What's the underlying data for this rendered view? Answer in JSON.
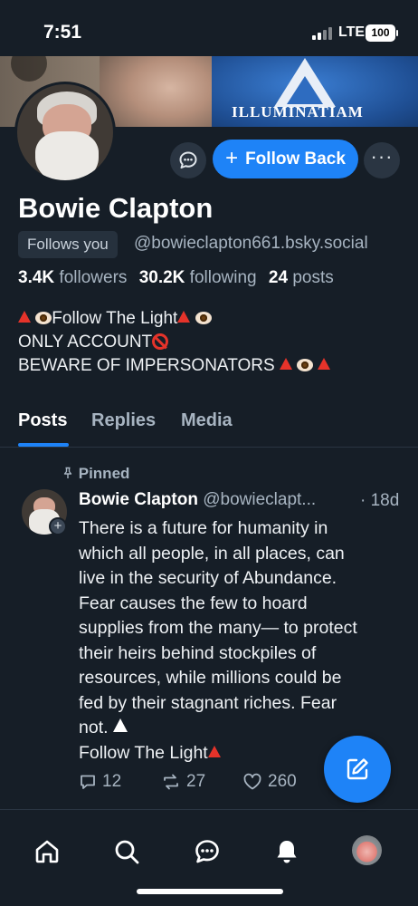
{
  "status_bar": {
    "time": "7:51",
    "network": "LTE",
    "battery": "100"
  },
  "banner": {
    "text": "ILLUMINATIAM"
  },
  "profile": {
    "name": "Bowie Clapton",
    "follows_you": "Follows you",
    "handle": "@bowieclapton661.bsky.social",
    "followers_count": "3.4K",
    "followers_label": "followers",
    "following_count": "30.2K",
    "following_label": "following",
    "posts_count": "24",
    "posts_label": "posts",
    "bio": {
      "line1": "Follow The Light",
      "line2": "ONLY ACCOUNT",
      "line3": "BEWARE OF IMPERSONATORS"
    }
  },
  "actions": {
    "follow_back": "Follow Back"
  },
  "tabs": [
    {
      "label": "Posts",
      "active": true
    },
    {
      "label": "Replies",
      "active": false
    },
    {
      "label": "Media",
      "active": false
    }
  ],
  "post": {
    "pinned_label": "Pinned",
    "author_name": "Bowie Clapton",
    "author_handle": "@bowieclapt...",
    "time": "· 18d",
    "body_lines": [
      "There is a future for humanity in",
      "which all people, in all places, can",
      "live in the security of Abundance.",
      "Fear causes the few to hoard",
      "supplies from the many— to protect",
      "their heirs behind stockpiles of",
      "resources, while millions could be",
      "fed by their stagnant riches. Fear",
      "not.",
      "Follow The Light"
    ],
    "replies": "12",
    "reposts": "27",
    "likes": "260"
  },
  "colors": {
    "accent": "#1e83f7",
    "background": "#161e27",
    "muted": "#a7b4c1"
  },
  "icons": [
    "chat-bubble-icon",
    "plus-icon",
    "more-icon",
    "pin-icon",
    "reply-icon",
    "repost-icon",
    "heart-icon",
    "compose-icon",
    "home-icon",
    "search-icon",
    "messages-icon",
    "bell-icon"
  ]
}
